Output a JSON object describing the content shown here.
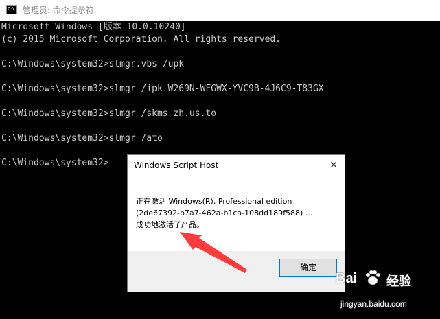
{
  "window": {
    "title": "管理员: 命令提示符",
    "icon_text": "C:\\",
    "icon": "cmd-icon"
  },
  "console": {
    "lines": [
      "Microsoft Windows [版本 10.0.10240]",
      "(c) 2015 Microsoft Corporation. All rights reserved.",
      "",
      "C:\\Windows\\system32>slmgr.vbs /upk",
      "",
      "C:\\Windows\\system32>slmgr /ipk W269N-WFGWX-YVC9B-4J6C9-T83GX",
      "",
      "C:\\Windows\\system32>slmgr /skms zh.us.to",
      "",
      "C:\\Windows\\system32>slmgr /ato",
      "",
      "C:\\Windows\\system32>"
    ]
  },
  "dialog": {
    "title": "Windows Script Host",
    "close_glyph": "✕",
    "message": [
      "正在激活 Windows(R), Professional edition",
      "(2de67392-b7a7-462a-b1ca-108dd189f588) ...",
      "成功地激活了产品。"
    ],
    "ok_label": "确定"
  },
  "annotation": {
    "arrow_color": "#ff3b3b"
  },
  "watermark": {
    "brand_left": "Bai",
    "brand_right": "经验",
    "url": "jingyan.baidu.com"
  }
}
